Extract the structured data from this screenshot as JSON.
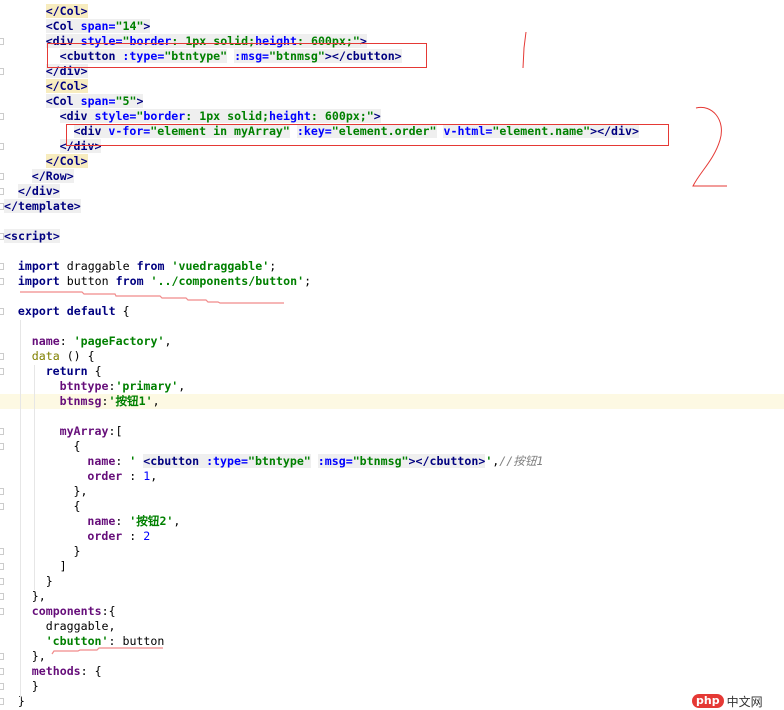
{
  "editor": {
    "lines": [
      {
        "indent": 3,
        "fold": false,
        "tokens": [
          [
            "ty",
            "</Col>"
          ]
        ]
      },
      {
        "indent": 3,
        "fold": false,
        "tokens": [
          [
            "t",
            "<Col "
          ],
          [
            "a",
            "span="
          ],
          [
            "v",
            "\"14\""
          ],
          [
            "t",
            ">"
          ]
        ]
      },
      {
        "indent": 3,
        "fold": true,
        "tokens": [
          [
            "t",
            "<div "
          ],
          [
            "a",
            "style="
          ],
          [
            "v",
            "\""
          ],
          [
            "a",
            "border"
          ],
          [
            "v",
            ": 1px solid;"
          ],
          [
            "a",
            "height"
          ],
          [
            "v",
            ": 600px;"
          ],
          [
            "v",
            "\""
          ],
          [
            "t",
            ">"
          ]
        ]
      },
      {
        "indent": 4,
        "fold": false,
        "tokens": [
          [
            "t",
            "<cbutton "
          ],
          [
            "a",
            ":type="
          ],
          [
            "v",
            "\"btntype\""
          ],
          [
            "o",
            " "
          ],
          [
            "a",
            ":msg="
          ],
          [
            "v",
            "\"btnmsg\""
          ],
          [
            "t",
            "></cbutton>"
          ]
        ]
      },
      {
        "indent": 3,
        "fold": true,
        "tokens": [
          [
            "t",
            "</div>"
          ]
        ]
      },
      {
        "indent": 3,
        "fold": false,
        "tokens": [
          [
            "ty",
            "</Col>"
          ]
        ]
      },
      {
        "indent": 3,
        "fold": false,
        "tokens": [
          [
            "t",
            "<Col "
          ],
          [
            "a",
            "span="
          ],
          [
            "v",
            "\"5\""
          ],
          [
            "t",
            ">"
          ]
        ]
      },
      {
        "indent": 4,
        "fold": true,
        "tokens": [
          [
            "t",
            "<div "
          ],
          [
            "a",
            "style="
          ],
          [
            "v",
            "\""
          ],
          [
            "a",
            "border"
          ],
          [
            "v",
            ": 1px solid;"
          ],
          [
            "a",
            "height"
          ],
          [
            "v",
            ": 600px;"
          ],
          [
            "v",
            "\""
          ],
          [
            "t",
            ">"
          ]
        ]
      },
      {
        "indent": 5,
        "fold": false,
        "tokens": [
          [
            "t",
            "<div "
          ],
          [
            "a",
            "v-for="
          ],
          [
            "v",
            "\"element in myArray\""
          ],
          [
            "o",
            " "
          ],
          [
            "a",
            ":key="
          ],
          [
            "v",
            "\"element.order\""
          ],
          [
            "o",
            " "
          ],
          [
            "a",
            "v-html="
          ],
          [
            "v",
            "\"element.name\""
          ],
          [
            "t",
            "></div>"
          ]
        ]
      },
      {
        "indent": 4,
        "fold": true,
        "tokens": [
          [
            "t",
            "</div>"
          ]
        ]
      },
      {
        "indent": 3,
        "fold": false,
        "tokens": [
          [
            "ty",
            "</Col>"
          ]
        ]
      },
      {
        "indent": 2,
        "fold": true,
        "tokens": [
          [
            "t",
            "</Row>"
          ]
        ]
      },
      {
        "indent": 1,
        "fold": true,
        "tokens": [
          [
            "t",
            "</div>"
          ]
        ]
      },
      {
        "indent": 0,
        "fold": true,
        "tokens": [
          [
            "t",
            "</template>"
          ]
        ]
      },
      {
        "indent": 0,
        "fold": false,
        "tokens": []
      },
      {
        "indent": 0,
        "fold": true,
        "tokens": [
          [
            "t",
            "<script>"
          ]
        ]
      },
      {
        "indent": 0,
        "fold": false,
        "tokens": []
      },
      {
        "indent": 1,
        "fold": true,
        "tokens": [
          [
            "k",
            "import "
          ],
          [
            "o",
            "draggable "
          ],
          [
            "k",
            "from "
          ],
          [
            "s",
            "'vuedraggable'"
          ],
          [
            "o",
            ";"
          ]
        ]
      },
      {
        "indent": 1,
        "fold": true,
        "tokens": [
          [
            "k",
            "import "
          ],
          [
            "o",
            "button "
          ],
          [
            "k",
            "from "
          ],
          [
            "s",
            "'../components/button'"
          ],
          [
            "o",
            ";"
          ]
        ]
      },
      {
        "indent": 0,
        "fold": false,
        "tokens": []
      },
      {
        "indent": 1,
        "fold": true,
        "tokens": [
          [
            "k",
            "export default "
          ],
          [
            "o",
            "{"
          ]
        ]
      },
      {
        "indent": 0,
        "fold": false,
        "tokens": []
      },
      {
        "indent": 2,
        "fold": false,
        "tokens": [
          [
            "p",
            "name"
          ],
          [
            "o",
            ": "
          ],
          [
            "s",
            "'pageFactory'"
          ],
          [
            "o",
            ","
          ]
        ]
      },
      {
        "indent": 2,
        "fold": true,
        "tokens": [
          [
            "f",
            "data "
          ],
          [
            "o",
            "() {"
          ]
        ]
      },
      {
        "indent": 3,
        "fold": true,
        "tokens": [
          [
            "k",
            "return "
          ],
          [
            "o",
            "{"
          ]
        ]
      },
      {
        "indent": 4,
        "fold": false,
        "tokens": [
          [
            "p",
            "btntype"
          ],
          [
            "o",
            ":"
          ],
          [
            "s",
            "'primary'"
          ],
          [
            "o",
            ","
          ]
        ]
      },
      {
        "indent": 4,
        "fold": false,
        "hl": true,
        "tokens": [
          [
            "p",
            "btnmsg"
          ],
          [
            "o",
            ":"
          ],
          [
            "s",
            "'按钮1'"
          ],
          [
            "o",
            ","
          ]
        ]
      },
      {
        "indent": 0,
        "fold": false,
        "tokens": []
      },
      {
        "indent": 4,
        "fold": true,
        "tokens": [
          [
            "p",
            "myArray"
          ],
          [
            "o",
            ":["
          ]
        ]
      },
      {
        "indent": 5,
        "fold": true,
        "tokens": [
          [
            "o",
            "{"
          ]
        ]
      },
      {
        "indent": 6,
        "fold": false,
        "tokens": [
          [
            "p",
            "name"
          ],
          [
            "o",
            ": "
          ],
          [
            "s",
            "' "
          ],
          [
            "t",
            "<cbutton "
          ],
          [
            "a",
            ":type="
          ],
          [
            "v",
            "\"btntype\""
          ],
          [
            "o",
            " "
          ],
          [
            "a",
            ":msg="
          ],
          [
            "v",
            "\"btnmsg\""
          ],
          [
            "t",
            "></cbutton>"
          ],
          [
            "s",
            "'"
          ],
          [
            "o",
            ","
          ],
          [
            "c",
            "//按钮1"
          ]
        ]
      },
      {
        "indent": 6,
        "fold": false,
        "tokens": [
          [
            "p",
            "order "
          ],
          [
            "o",
            ": "
          ],
          [
            "n",
            "1"
          ],
          [
            "o",
            ","
          ]
        ]
      },
      {
        "indent": 5,
        "fold": true,
        "tokens": [
          [
            "o",
            "},"
          ]
        ]
      },
      {
        "indent": 5,
        "fold": true,
        "tokens": [
          [
            "o",
            "{"
          ]
        ]
      },
      {
        "indent": 6,
        "fold": false,
        "tokens": [
          [
            "p",
            "name"
          ],
          [
            "o",
            ": "
          ],
          [
            "s",
            "'按钮2'"
          ],
          [
            "o",
            ","
          ]
        ]
      },
      {
        "indent": 6,
        "fold": false,
        "tokens": [
          [
            "p",
            "order "
          ],
          [
            "o",
            ": "
          ],
          [
            "n",
            "2"
          ]
        ]
      },
      {
        "indent": 5,
        "fold": true,
        "tokens": [
          [
            "o",
            "}"
          ]
        ]
      },
      {
        "indent": 4,
        "fold": true,
        "tokens": [
          [
            "o",
            "]"
          ]
        ]
      },
      {
        "indent": 3,
        "fold": true,
        "tokens": [
          [
            "o",
            "}"
          ]
        ]
      },
      {
        "indent": 2,
        "fold": true,
        "tokens": [
          [
            "o",
            "},"
          ]
        ]
      },
      {
        "indent": 2,
        "fold": true,
        "tokens": [
          [
            "p",
            "components"
          ],
          [
            "o",
            ":{"
          ]
        ]
      },
      {
        "indent": 3,
        "fold": false,
        "tokens": [
          [
            "o",
            "draggable,"
          ]
        ]
      },
      {
        "indent": 3,
        "fold": false,
        "tokens": [
          [
            "s",
            "'cbutton'"
          ],
          [
            "o",
            ": button"
          ]
        ]
      },
      {
        "indent": 2,
        "fold": true,
        "tokens": [
          [
            "o",
            "},"
          ]
        ]
      },
      {
        "indent": 2,
        "fold": true,
        "tokens": [
          [
            "p",
            "methods"
          ],
          [
            "o",
            ": {"
          ]
        ]
      },
      {
        "indent": 2,
        "fold": true,
        "tokens": [
          [
            "o",
            "}"
          ]
        ]
      },
      {
        "indent": 1,
        "fold": true,
        "tokens": [
          [
            "o",
            "}"
          ]
        ]
      }
    ]
  },
  "annotations": {
    "label_1": "1",
    "label_2": "2",
    "color": "#e53935"
  },
  "watermark": {
    "brand": "php",
    "text": "中文网"
  }
}
